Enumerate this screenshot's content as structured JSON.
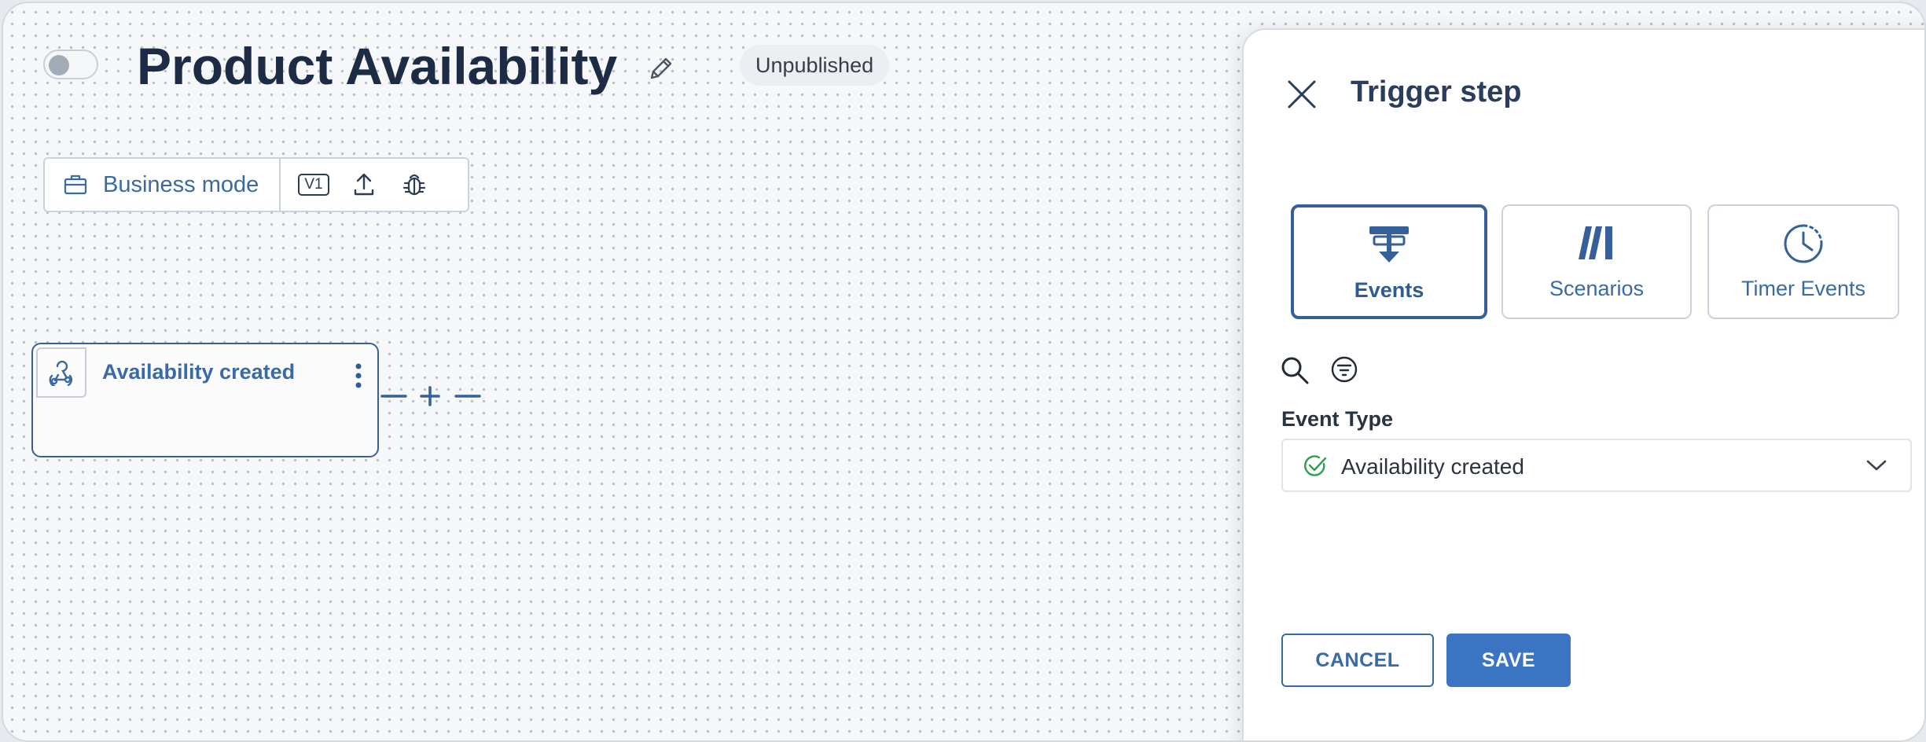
{
  "header": {
    "title": "Product Availability",
    "status": "Unpublished"
  },
  "toolbar": {
    "mode_label": "Business mode",
    "version_label": "V1"
  },
  "canvas": {
    "node": {
      "title": "Availability created"
    }
  },
  "panel": {
    "title": "Trigger step",
    "tabs": [
      {
        "label": "Events",
        "icon": "event-icon",
        "active": true
      },
      {
        "label": "Scenarios",
        "icon": "scenarios-icon",
        "active": false
      },
      {
        "label": "Timer Events",
        "icon": "timer-icon",
        "active": false
      }
    ],
    "event_type": {
      "label": "Event Type",
      "value": "Availability created"
    },
    "cancel_label": "CANCEL",
    "save_label": "SAVE"
  },
  "colors": {
    "accent": "#3a6aa5",
    "primary_button": "#3a74c2",
    "title": "#1d2b45",
    "success": "#2e9d4f"
  }
}
